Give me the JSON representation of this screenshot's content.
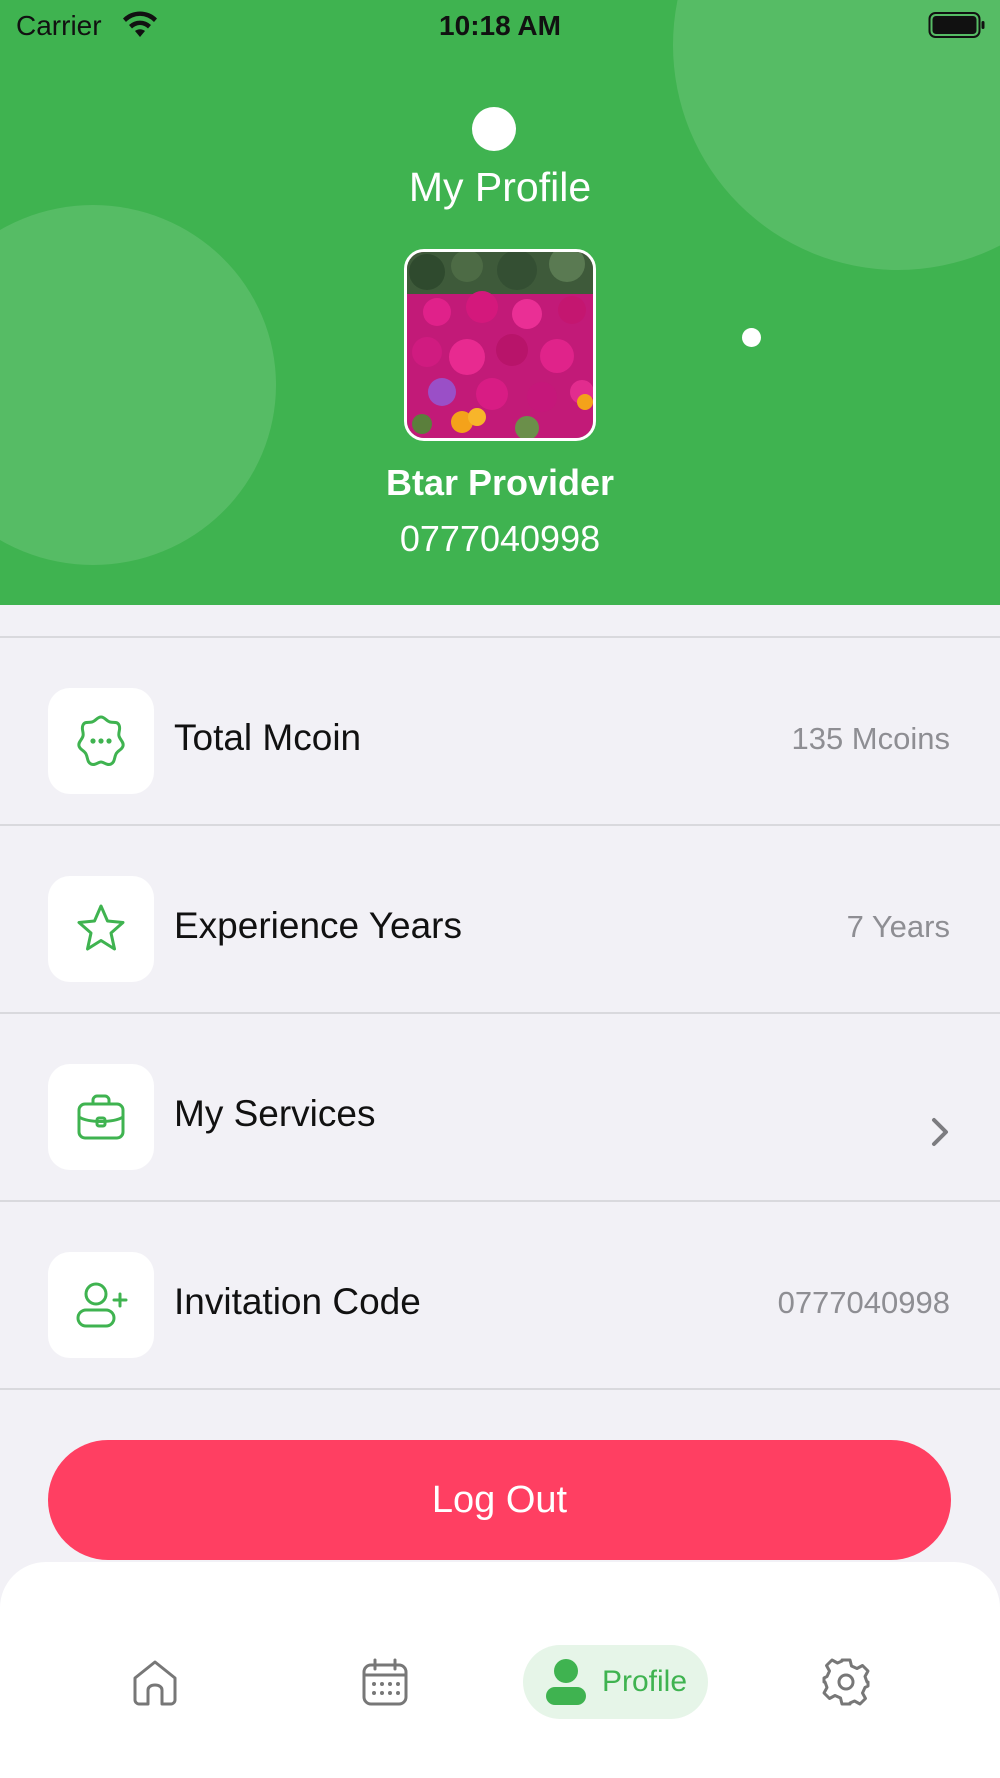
{
  "status_bar": {
    "carrier": "Carrier",
    "time": "10:18 AM"
  },
  "header": {
    "title": "My Profile",
    "user_name": "Btar Provider",
    "user_phone": "0777040998"
  },
  "rows": [
    {
      "label": "Total Mcoin",
      "value": "135 Mcoins",
      "icon": "coin-badge-icon"
    },
    {
      "label": "Experience Years",
      "value": "7 Years",
      "icon": "star-icon"
    },
    {
      "label": "My Services",
      "value": "",
      "icon": "briefcase-icon"
    },
    {
      "label": "Invitation Code",
      "value": "0777040998",
      "icon": "add-user-icon"
    }
  ],
  "logout": {
    "label": "Log Out"
  },
  "tabbar": {
    "items": [
      {
        "icon": "home-icon",
        "label": ""
      },
      {
        "icon": "calendar-icon",
        "label": ""
      },
      {
        "icon": "profile-icon",
        "label": "Profile",
        "active": true
      },
      {
        "icon": "gear-icon",
        "label": ""
      }
    ]
  },
  "colors": {
    "brand_green": "#3fb350",
    "logout_red": "#ff3f62",
    "background": "#f2f1f6"
  }
}
